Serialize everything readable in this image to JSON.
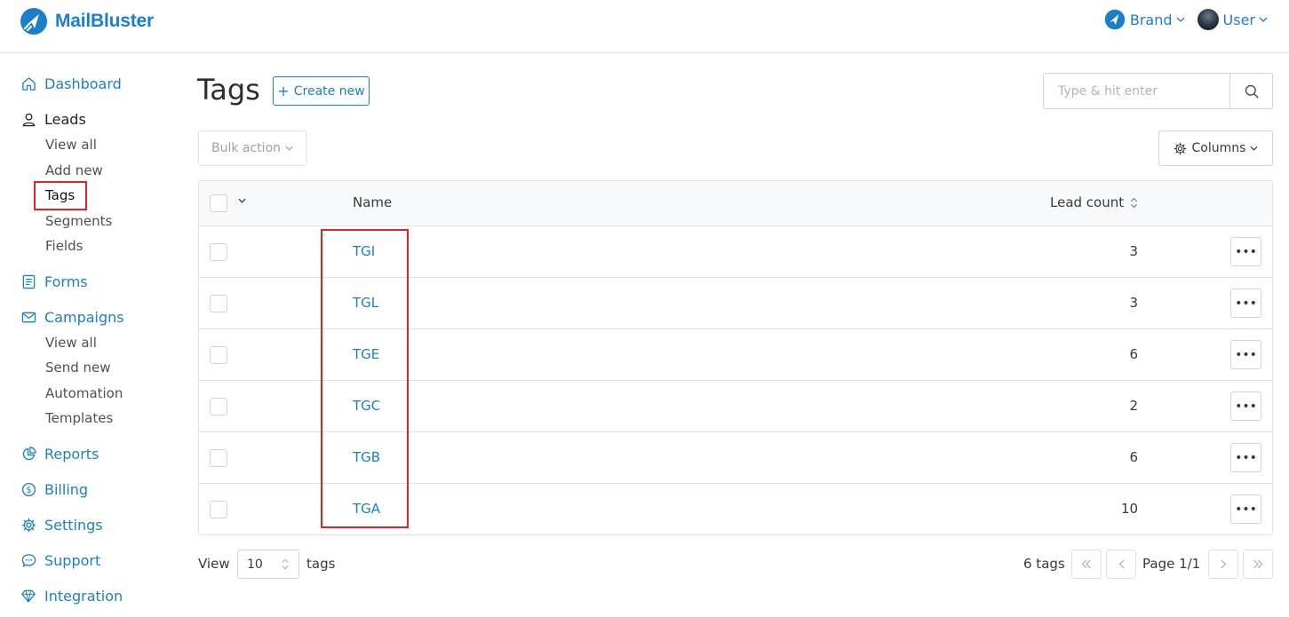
{
  "app": {
    "name": "MailBluster",
    "brand_color": "#1a7fc8",
    "highlight_color": "#e02424"
  },
  "header": {
    "brand_label": "Brand",
    "user_label": "User"
  },
  "sidebar": {
    "dashboard": "Dashboard",
    "leads": "Leads",
    "leads_sub": [
      "View all",
      "Add new",
      "Tags",
      "Segments",
      "Fields"
    ],
    "forms": "Forms",
    "campaigns": "Campaigns",
    "campaigns_sub": [
      "View all",
      "Send new",
      "Automation",
      "Templates"
    ],
    "reports": "Reports",
    "billing": "Billing",
    "settings": "Settings",
    "support": "Support",
    "integration": "Integration",
    "active_item": "Tags"
  },
  "page": {
    "title": "Tags",
    "create_label": "Create new",
    "search_placeholder": "Type & hit enter",
    "bulk_label": "Bulk action",
    "columns_label": "Columns"
  },
  "table": {
    "col_name": "Name",
    "col_count": "Lead count",
    "rows": [
      {
        "name": "TGI",
        "count": "3"
      },
      {
        "name": "TGL",
        "count": "3"
      },
      {
        "name": "TGE",
        "count": "6"
      },
      {
        "name": "TGC",
        "count": "2"
      },
      {
        "name": "TGB",
        "count": "6"
      },
      {
        "name": "TGA",
        "count": "10"
      }
    ]
  },
  "footer": {
    "view_label": "View",
    "per_page": "10",
    "tags_label": "tags",
    "total": "6 tags",
    "page_label": "Page 1/1"
  }
}
